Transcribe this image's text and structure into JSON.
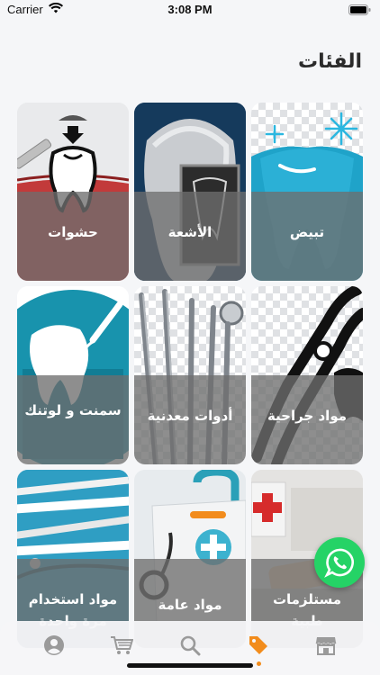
{
  "status_bar": {
    "carrier": "Carrier",
    "time": "3:08 PM"
  },
  "page": {
    "title": "الفئات"
  },
  "categories": [
    {
      "label": "تبيض",
      "icon": "whitening-tooth-icon"
    },
    {
      "label": "الأشعة",
      "icon": "xray-tooth-icon"
    },
    {
      "label": "حشوات",
      "icon": "filling-tooth-icon"
    },
    {
      "label": "مواد جراحية",
      "icon": "extraction-forceps-icon"
    },
    {
      "label": "أدوات معدنية",
      "icon": "metal-instruments-icon"
    },
    {
      "label": "سمنت و لوتنك",
      "icon": "cement-tooth-icon"
    },
    {
      "label": "مستلزمات طبية",
      "icon": "medical-supplies-icon"
    },
    {
      "label": "مواد عامة",
      "icon": "first-aid-bag-icon"
    },
    {
      "label": "مواد استخدام مرة واحدة",
      "icon": "disposable-tools-icon"
    }
  ],
  "tab_bar": {
    "items": [
      "store-icon",
      "tag-icon",
      "search-icon",
      "cart-icon",
      "profile-icon"
    ],
    "active": "tag-icon",
    "accent": "#f28c1c",
    "inactive": "#9a9a9a"
  },
  "whatsapp": {
    "icon": "whatsapp-icon",
    "color": "#25d366"
  }
}
